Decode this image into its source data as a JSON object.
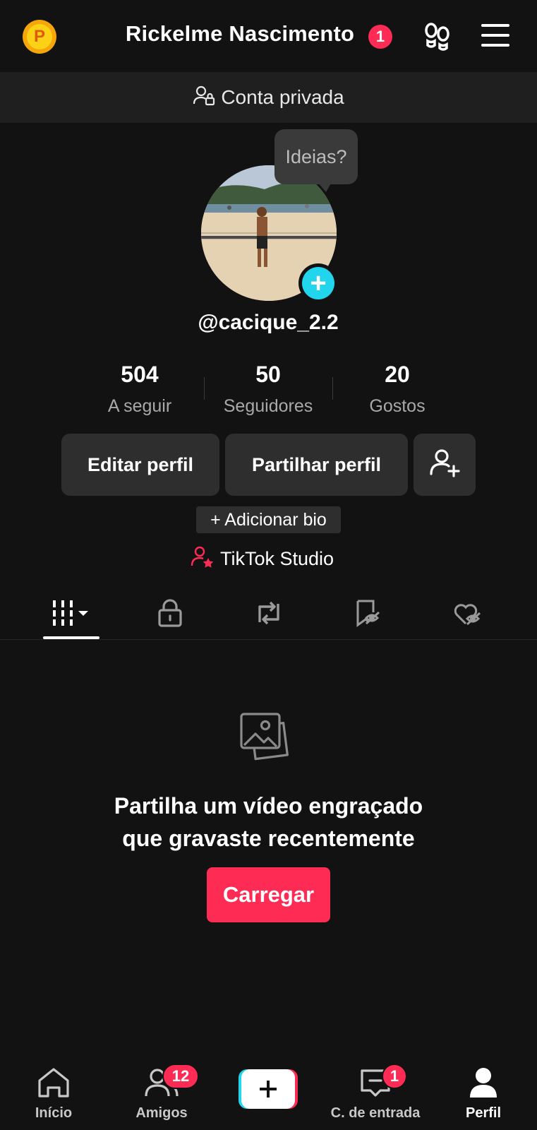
{
  "header": {
    "coin_letter": "P",
    "title": "Rickelme Nascimento",
    "notification_count": "1"
  },
  "private_bar": {
    "label": "Conta privada"
  },
  "profile": {
    "bubble": "Ideias?",
    "handle": "@cacique_2.2",
    "stats": [
      {
        "value": "504",
        "label": "A seguir"
      },
      {
        "value": "50",
        "label": "Seguidores"
      },
      {
        "value": "20",
        "label": "Gostos"
      }
    ],
    "edit_label": "Editar perfil",
    "share_label": "Partilhar perfil",
    "add_bio": "+ Adicionar bio",
    "studio": "TikTok Studio"
  },
  "empty_state": {
    "line1": "Partilha um vídeo engraçado",
    "line2": "que gravaste recentemente",
    "upload_label": "Carregar"
  },
  "bottom_nav": {
    "home": "Início",
    "friends": "Amigos",
    "friends_badge": "12",
    "inbox": "C. de entrada",
    "inbox_badge": "1",
    "profile": "Perfil"
  },
  "colors": {
    "accent": "#fe2c55",
    "cyan": "#20d5ec",
    "background": "#121212",
    "surface": "#2e2e2e"
  }
}
